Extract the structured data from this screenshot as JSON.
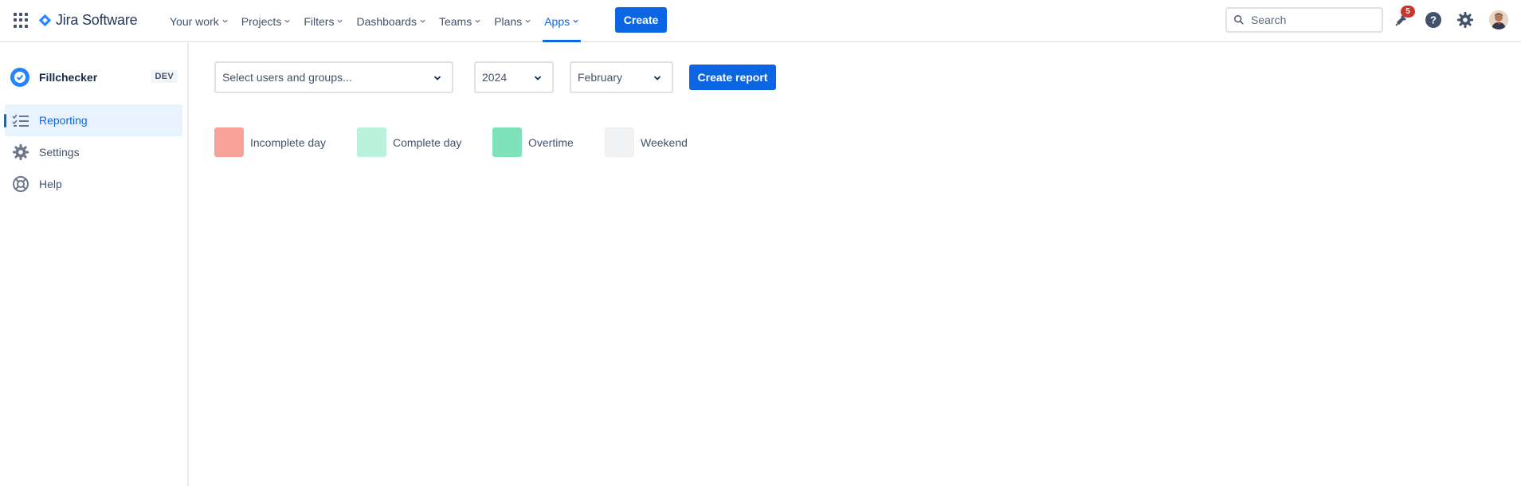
{
  "header": {
    "app_name": "Jira Software",
    "nav": [
      {
        "label": "Your work"
      },
      {
        "label": "Projects"
      },
      {
        "label": "Filters"
      },
      {
        "label": "Dashboards"
      },
      {
        "label": "Teams"
      },
      {
        "label": "Plans"
      },
      {
        "label": "Apps",
        "active": true
      }
    ],
    "create_label": "Create",
    "search_placeholder": "Search",
    "notification_count": "5",
    "icons": [
      "app-switcher-icon",
      "jira-logo-icon",
      "search-icon",
      "notifications-icon",
      "help-icon",
      "settings-icon",
      "avatar"
    ]
  },
  "sidebar": {
    "project_name": "Fillchecker",
    "project_tag": "DEV",
    "items": [
      {
        "label": "Reporting",
        "icon": "list-checklist-icon",
        "active": true
      },
      {
        "label": "Settings",
        "icon": "gear-icon"
      },
      {
        "label": "Help",
        "icon": "lifebuoy-icon"
      }
    ]
  },
  "filters": {
    "users_placeholder": "Select users and groups...",
    "year": "2024",
    "month": "February",
    "create_report_label": "Create report"
  },
  "legend": [
    {
      "label": "Incomplete day",
      "color": "#f8a199"
    },
    {
      "label": "Complete day",
      "color": "#baf3db"
    },
    {
      "label": "Overtime",
      "color": "#7ee2b8"
    },
    {
      "label": "Weekend",
      "color": "#f1f2f4"
    }
  ],
  "colors": {
    "accent": "#0c66e4",
    "badge": "#c9372c"
  }
}
